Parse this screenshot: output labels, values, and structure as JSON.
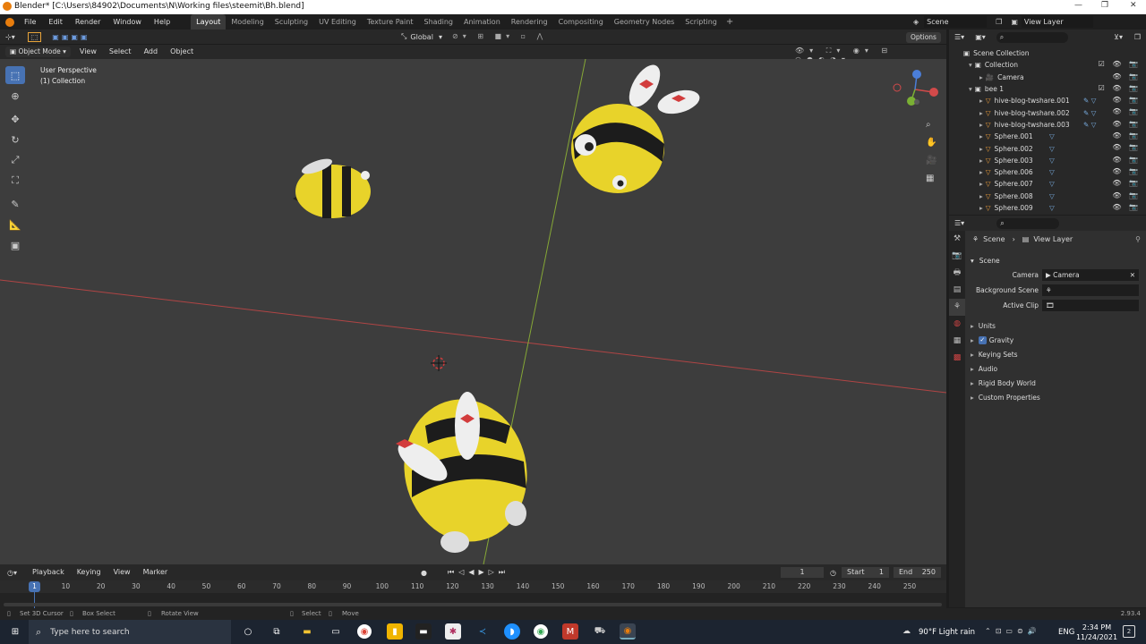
{
  "window": {
    "title": "Blender* [C:\\Users\\84902\\Documents\\N\\Working files\\steemit\\Bh.blend]"
  },
  "menu": [
    "File",
    "Edit",
    "Render",
    "Window",
    "Help"
  ],
  "workspaces": [
    "Layout",
    "Modeling",
    "Sculpting",
    "UV Editing",
    "Texture Paint",
    "Shading",
    "Animation",
    "Rendering",
    "Compositing",
    "Geometry Nodes",
    "Scripting"
  ],
  "active_workspace": "Layout",
  "scene_selector": {
    "scene": "Scene",
    "view_layer": "View Layer"
  },
  "viewport_header": {
    "mode": "Object Mode",
    "menus": [
      "View",
      "Select",
      "Add",
      "Object"
    ],
    "orientation": "Global",
    "options": "Options"
  },
  "viewport_info": {
    "perspective": "User Perspective",
    "collection": "(1) Collection"
  },
  "outliner": {
    "scene_collection": "Scene Collection",
    "items": [
      {
        "name": "Collection",
        "level": 1
      },
      {
        "name": "Camera",
        "level": 2
      },
      {
        "name": "bee 1",
        "level": 1
      },
      {
        "name": "hive-blog-twshare.001",
        "level": 2
      },
      {
        "name": "hive-blog-twshare.002",
        "level": 2
      },
      {
        "name": "hive-blog-twshare.003",
        "level": 2
      },
      {
        "name": "Sphere.001",
        "level": 2
      },
      {
        "name": "Sphere.002",
        "level": 2
      },
      {
        "name": "Sphere.003",
        "level": 2
      },
      {
        "name": "Sphere.006",
        "level": 2
      },
      {
        "name": "Sphere.007",
        "level": 2
      },
      {
        "name": "Sphere.008",
        "level": 2
      },
      {
        "name": "Sphere.009",
        "level": 2
      }
    ]
  },
  "properties": {
    "breadcrumb_scene": "Scene",
    "breadcrumb_view_layer": "View Layer",
    "panel_title": "Scene",
    "camera_label": "Camera",
    "camera_value": "Camera",
    "background_scene_label": "Background Scene",
    "active_clip_label": "Active Clip",
    "sections": [
      "Units",
      "Gravity",
      "Keying Sets",
      "Audio",
      "Rigid Body World",
      "Custom Properties"
    ]
  },
  "timeline": {
    "menus": [
      "Playback",
      "Keying",
      "View",
      "Marker"
    ],
    "current_frame": "1",
    "start_label": "Start",
    "start_value": "1",
    "end_label": "End",
    "end_value": "250",
    "ticks": [
      "10",
      "20",
      "30",
      "40",
      "50",
      "60",
      "70",
      "80",
      "90",
      "100",
      "110",
      "120",
      "130",
      "140",
      "150",
      "160",
      "170",
      "180",
      "190",
      "200",
      "210",
      "220",
      "230",
      "240",
      "250"
    ],
    "playhead": "1"
  },
  "statusbar": {
    "items": [
      "Set 3D Cursor",
      "Box Select",
      "Rotate View",
      "Select",
      "Move"
    ],
    "version": "2.93.4"
  },
  "taskbar": {
    "search_placeholder": "Type here to search",
    "weather": "90°F  Light rain",
    "language": "ENG",
    "time": "2:34 PM",
    "date": "11/24/2021",
    "notifications": "2"
  }
}
